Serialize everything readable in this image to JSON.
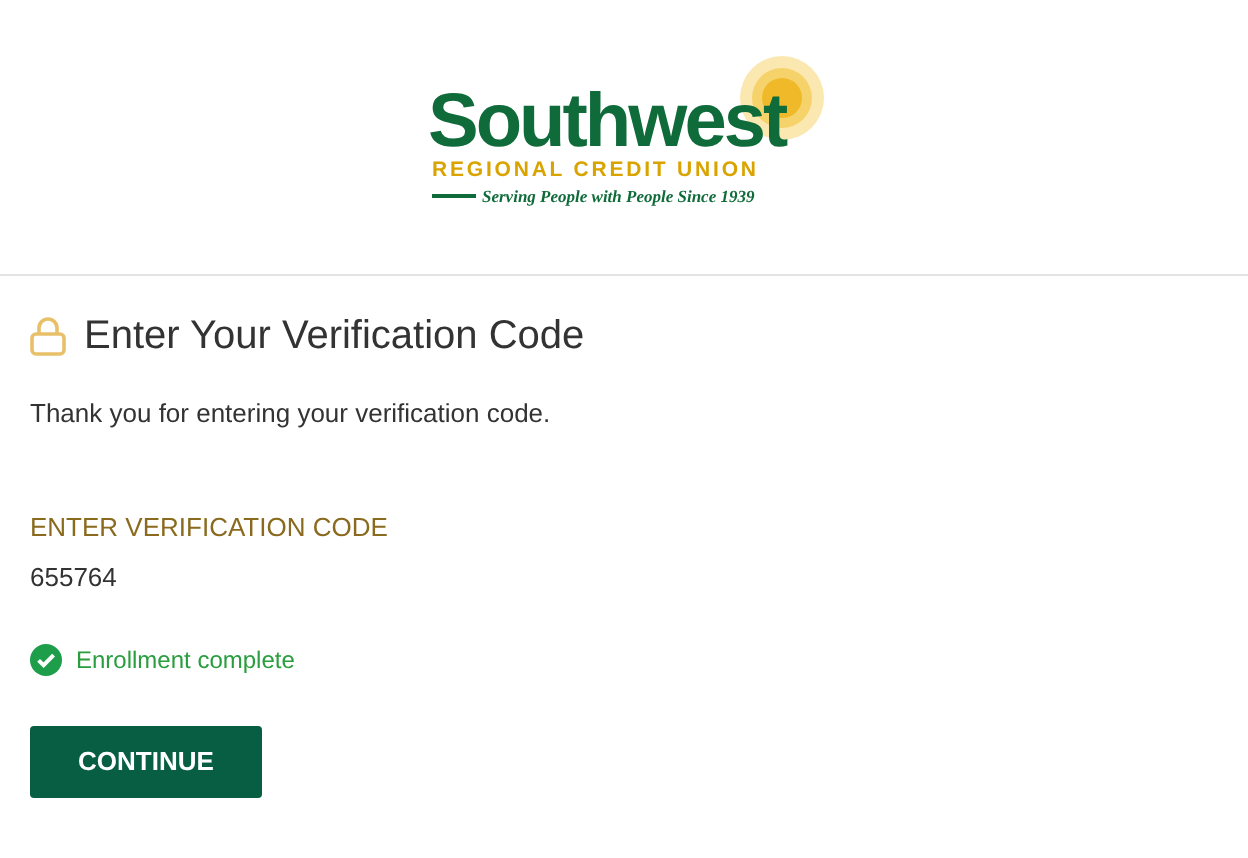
{
  "logo": {
    "name": "Southwest",
    "subtitle": "REGIONAL CREDIT UNION",
    "tagline": "Serving People with People Since 1939"
  },
  "title": "Enter Your Verification Code",
  "message": "Thank you for entering your verification code.",
  "field": {
    "label": "ENTER VERIFICATION CODE",
    "value": "655764"
  },
  "status": {
    "kind": "success",
    "text": "Enrollment complete"
  },
  "buttons": [
    "CONTINUE"
  ]
}
